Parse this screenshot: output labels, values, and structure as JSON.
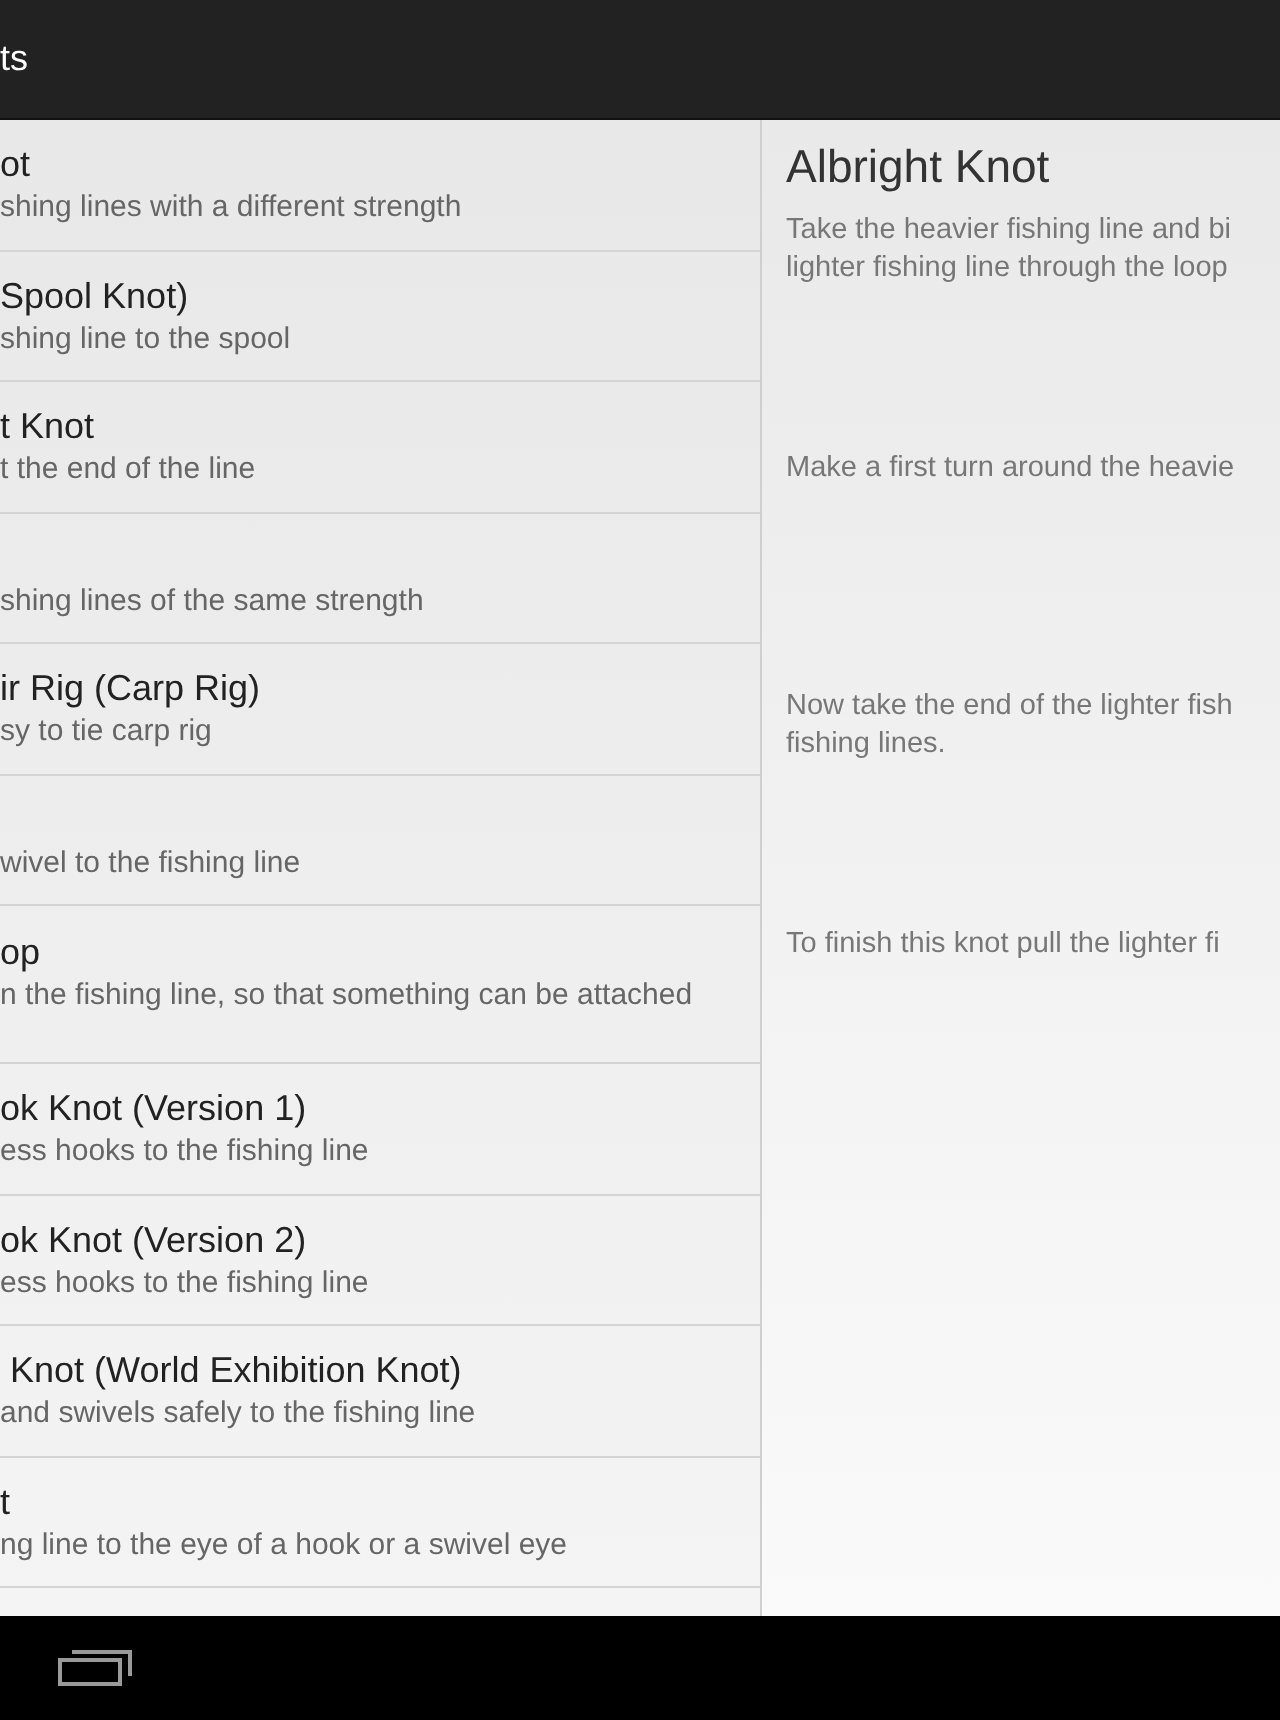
{
  "action_bar": {
    "title": "ts"
  },
  "knots": [
    {
      "title": "ot",
      "subtitle": "shing lines with a different strength",
      "selected": false
    },
    {
      "title": "Spool Knot)",
      "subtitle": "shing line to the spool",
      "selected": false
    },
    {
      "title": "t Knot",
      "subtitle": "t the end of the line",
      "selected": false
    },
    {
      "subtitle": "shing lines of the same strength",
      "selected": false
    },
    {
      "title": "ir Rig (Carp Rig)",
      "subtitle": "sy to tie carp rig",
      "selected": false
    },
    {
      "subtitle": "wivel to the fishing line",
      "selected": false
    },
    {
      "title": "op",
      "subtitle": "n the fishing line, so that something can be attached",
      "selected": false
    },
    {
      "title": "ok Knot (Version 1)",
      "subtitle": "ess hooks to the fishing line",
      "selected": false
    },
    {
      "title": "ok Knot (Version 2)",
      "subtitle": "ess hooks to the fishing line",
      "selected": false
    },
    {
      "title": " Knot (World Exhibition Knot)",
      "subtitle": "and swivels safely to the fishing line",
      "selected": false
    },
    {
      "title": "t",
      "subtitle": "ng line to the eye of a hook or a swivel eye",
      "selected": false
    }
  ],
  "detail": {
    "title": "Albright Knot",
    "steps": [
      {
        "lines": [
          "Take the heavier fishing line and bi",
          "lighter fishing line through the loop"
        ]
      },
      {
        "lines": [
          "Make a first turn around the heavie"
        ]
      },
      {
        "lines": [
          "Now take the end of the lighter fish",
          "fishing lines."
        ]
      },
      {
        "lines": [
          "To finish this knot pull the lighter fi"
        ]
      }
    ]
  }
}
